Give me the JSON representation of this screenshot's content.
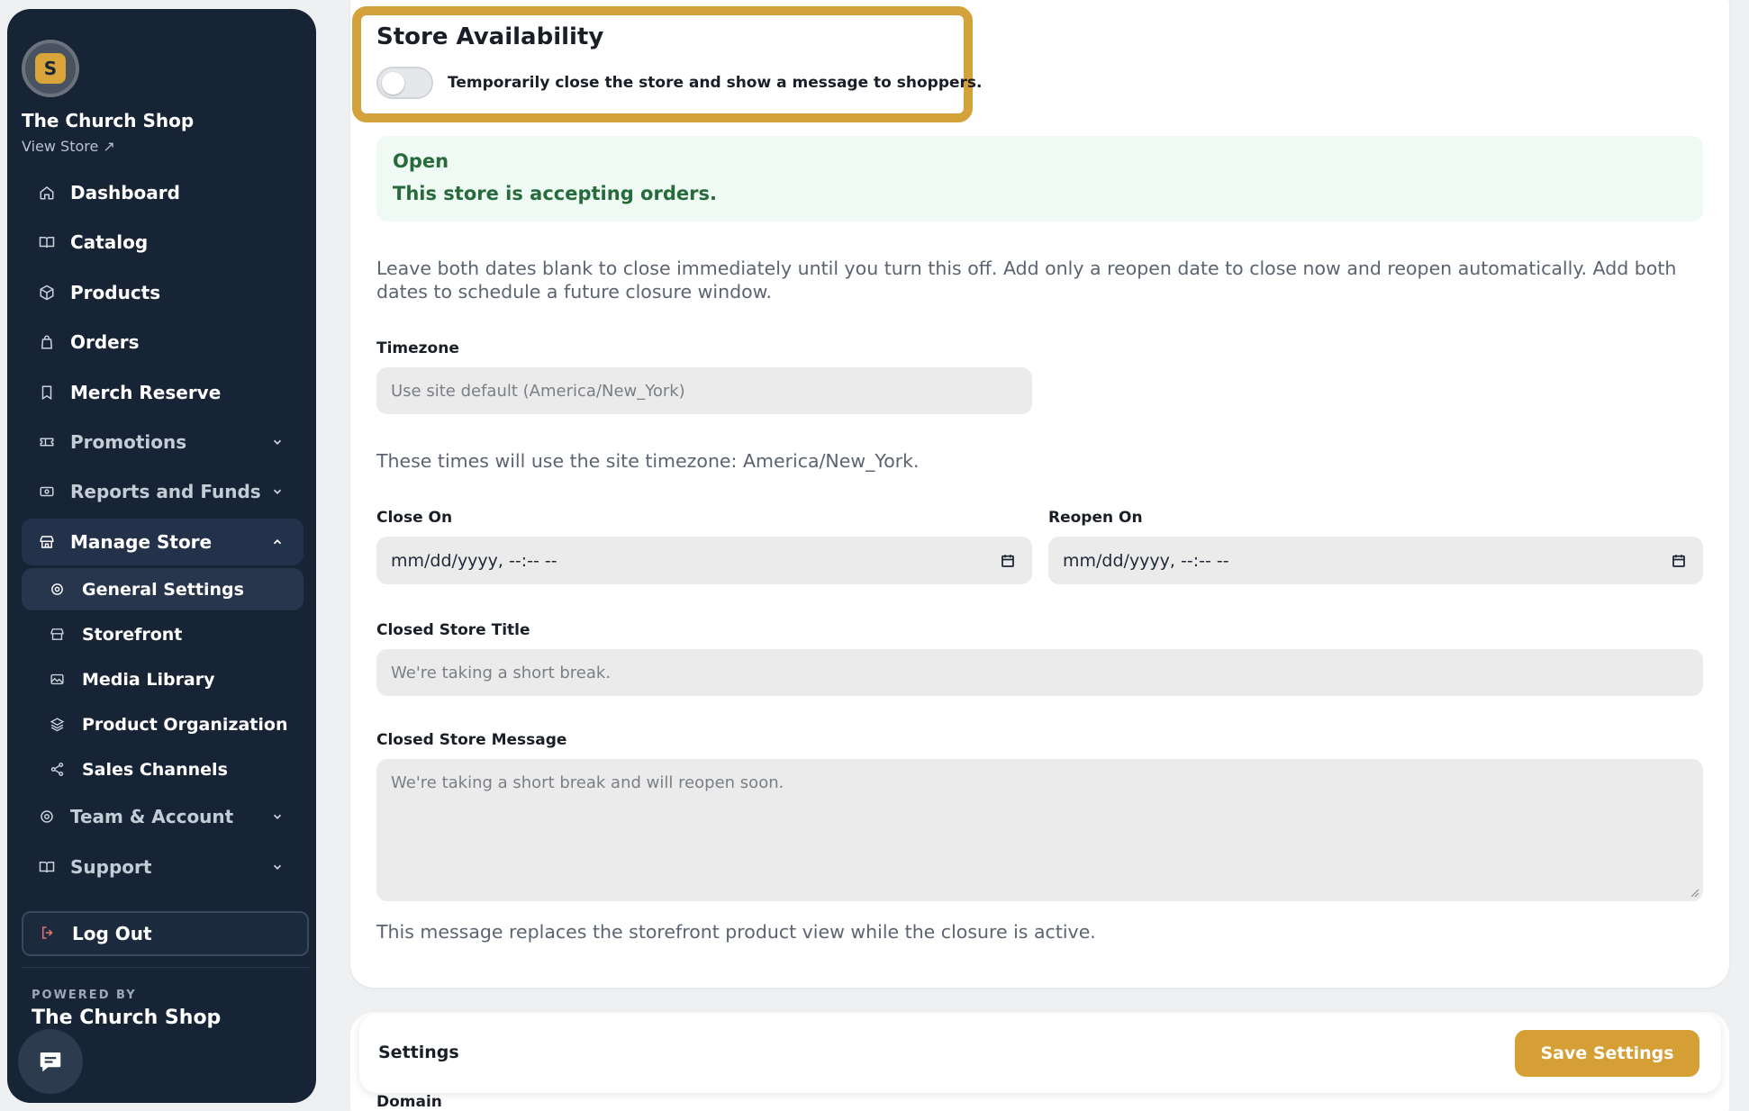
{
  "brand": {
    "logo_letter": "S",
    "name": "The Church Shop",
    "view_store": "View Store ↗"
  },
  "nav": [
    {
      "label": "Dashboard",
      "icon": "home-icon"
    },
    {
      "label": "Catalog",
      "icon": "book-icon"
    },
    {
      "label": "Products",
      "icon": "box-icon"
    },
    {
      "label": "Orders",
      "icon": "bag-icon"
    },
    {
      "label": "Merch Reserve",
      "icon": "bookmark-icon"
    },
    {
      "label": "Promotions",
      "icon": "ticket-icon"
    },
    {
      "label": "Reports and Funds",
      "icon": "money-icon"
    },
    {
      "label": "Manage Store",
      "icon": "store-icon"
    }
  ],
  "subnav": [
    {
      "label": "General Settings",
      "icon": "settings-icon"
    },
    {
      "label": "Storefront",
      "icon": "store-icon"
    },
    {
      "label": "Media Library",
      "icon": "image-icon"
    },
    {
      "label": "Product Organization",
      "icon": "layers-icon"
    },
    {
      "label": "Sales Channels",
      "icon": "share-icon"
    }
  ],
  "nav_after": [
    {
      "label": "Team & Account",
      "icon": "settings-icon"
    },
    {
      "label": "Support",
      "icon": "book-icon"
    }
  ],
  "logout_label": "Log Out",
  "powered_by": "POWERED BY",
  "powered_name": "The Church Shop",
  "availability": {
    "title": "Store Availability",
    "toggle_label": "Temporarily close the store and show a message to shoppers.",
    "toggle_on": false
  },
  "status": {
    "title": "Open",
    "text": "This store is accepting orders."
  },
  "help_text": "Leave both dates blank to close immediately until you turn this off. Add only a reopen date to close now and reopen automatically. Add both dates to schedule a future closure window.",
  "timezone": {
    "label": "Timezone",
    "placeholder": "Use site default (America/New_York)",
    "note": "These times will use the site timezone: America/New_York."
  },
  "close_on": {
    "label": "Close On",
    "value": "mm/dd/yyyy, --:-- --"
  },
  "reopen_on": {
    "label": "Reopen On",
    "value": "mm/dd/yyyy, --:-- --"
  },
  "closed_title": {
    "label": "Closed Store Title",
    "placeholder": "We're taking a short break."
  },
  "closed_message": {
    "label": "Closed Store Message",
    "placeholder": "We're taking a short break and will reopen soon.",
    "note": "This message replaces the storefront product view while the closure is active."
  },
  "settings_bar": {
    "title": "Settings",
    "save_label": "Save Settings",
    "peek_label": "Domain"
  },
  "colors": {
    "sidebar_bg": "#172436",
    "accent": "#d69f35",
    "status_bg": "#eefaf3",
    "status_text": "#276a3b"
  }
}
